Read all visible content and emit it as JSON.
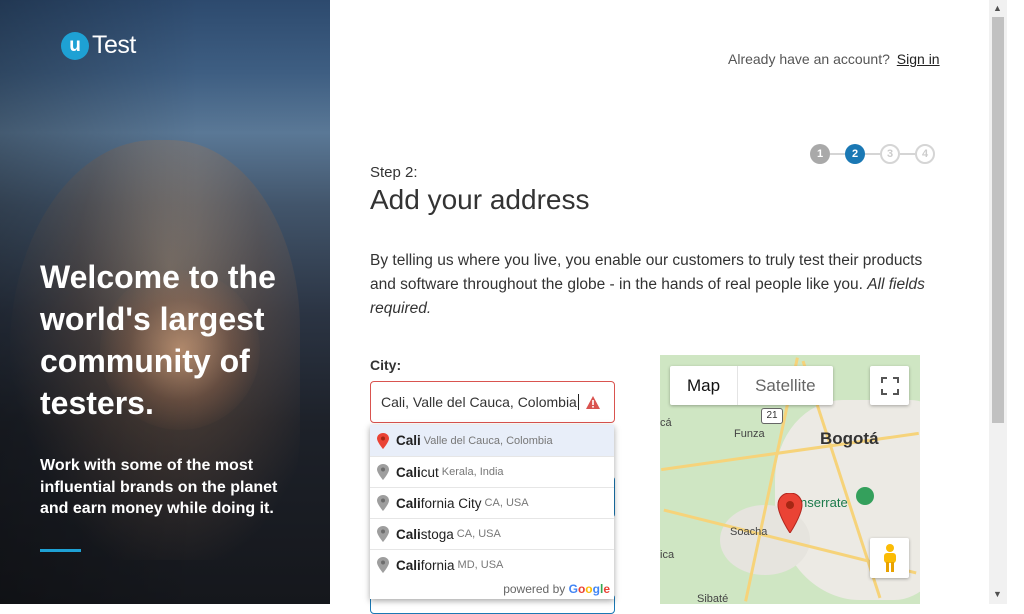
{
  "brand": {
    "logo_mark": "u",
    "logo_text": "Test"
  },
  "hero": {
    "headline": "Welcome to the world's largest community of testers.",
    "subtext": "Work with some of the most influential brands on the planet and earn money while doing it."
  },
  "header": {
    "account_prompt": "Already have an account?",
    "signin_label": "Sign in"
  },
  "steps": {
    "items": [
      "1",
      "2",
      "3",
      "4"
    ],
    "current": 2
  },
  "form": {
    "step_label": "Step 2:",
    "title": "Add your address",
    "description": "By telling us where you live, you enable our customers to truly test their products and software throughout the globe - in the hands of real people like you.",
    "required_note": "All fields required.",
    "city_label": "City:",
    "city_value": "Cali, Valle del Cauca, Colombia"
  },
  "autocomplete": {
    "items": [
      {
        "match": "Cali",
        "rest": "",
        "secondary": "Valle del Cauca, Colombia",
        "selected": true
      },
      {
        "match": "Cali",
        "rest": "cut",
        "secondary": "Kerala, India"
      },
      {
        "match": "Cali",
        "rest": "fornia City",
        "secondary": "CA, USA"
      },
      {
        "match": "Cali",
        "rest": "stoga",
        "secondary": "CA, USA"
      },
      {
        "match": "Cali",
        "rest": "fornia",
        "secondary": "MD, USA"
      }
    ],
    "powered_by": "powered by",
    "google": [
      "G",
      "o",
      "o",
      "g",
      "l",
      "e"
    ]
  },
  "map": {
    "tab_map": "Map",
    "tab_satellite": "Satellite",
    "city_label": "Bogotá",
    "labels": [
      "Funza",
      "Soacha",
      "Sibaté",
      "Cajicá",
      "ica",
      "cá"
    ],
    "park_label": "nserrate",
    "road_shield": "21"
  },
  "colors": {
    "accent": "#1ea1d4",
    "step_active": "#1a78b4",
    "error": "#d9534f",
    "marker": "#ea4335"
  }
}
